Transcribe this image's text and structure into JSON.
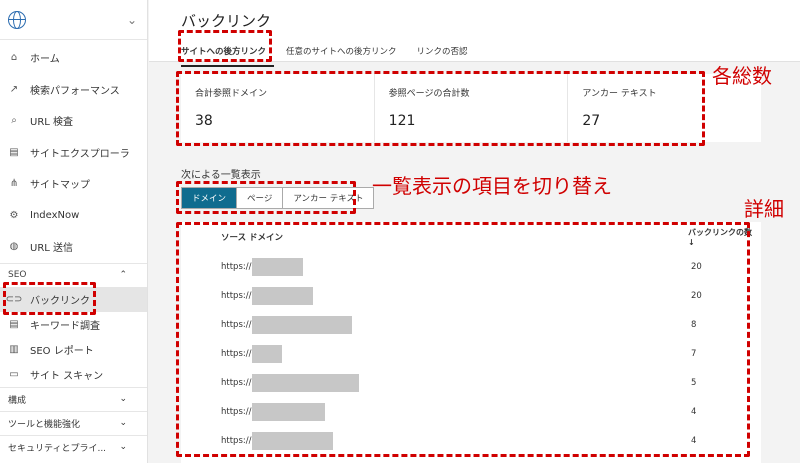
{
  "sidebar": {
    "items": [
      {
        "label": "ホーム",
        "icon": "home-icon",
        "glyph": "⌂"
      },
      {
        "label": "検索パフォーマンス",
        "icon": "trend-icon",
        "glyph": "↗"
      },
      {
        "label": "URL 検査",
        "icon": "search-icon",
        "glyph": "⌕"
      },
      {
        "label": "サイトエクスプローラ",
        "icon": "document-icon",
        "glyph": "▤"
      },
      {
        "label": "サイトマップ",
        "icon": "sitemap-icon",
        "glyph": "⋔"
      },
      {
        "label": "IndexNow",
        "icon": "gear-icon",
        "glyph": "⚙"
      },
      {
        "label": "URL 送信",
        "icon": "globe-icon",
        "glyph": "◍"
      }
    ],
    "seo_section": "SEO",
    "seo_items": [
      {
        "label": "バックリンク",
        "icon": "link-icon",
        "glyph": "⊂⊃"
      },
      {
        "label": "キーワード調査",
        "icon": "document-icon",
        "glyph": "▤"
      },
      {
        "label": "SEO レポート",
        "icon": "report-icon",
        "glyph": "▥"
      },
      {
        "label": "サイト スキャン",
        "icon": "scan-icon",
        "glyph": "▭"
      }
    ],
    "collapsed": [
      "構成",
      "ツールと機能強化",
      "セキュリティとプライ..."
    ]
  },
  "header": {
    "title": "バックリンク",
    "tabs": [
      "サイトへの後方リンク",
      "任意のサイトへの後方リンク",
      "リンクの否認"
    ]
  },
  "stats": [
    {
      "label": "合計参照ドメイン",
      "value": "38"
    },
    {
      "label": "参照ページの合計数",
      "value": "121"
    },
    {
      "label": "アンカー テキスト",
      "value": "27"
    }
  ],
  "list": {
    "caption": "次による一覧表示",
    "toggles": [
      "ドメイン",
      "ページ",
      "アンカー テキスト"
    ]
  },
  "table": {
    "col_source": "ソース ドメイン",
    "col_count": "バックリンクの数 ↓",
    "rows": [
      {
        "prefix": "https://",
        "count": "20",
        "redact_fraction": 0.39
      },
      {
        "prefix": "https://",
        "count": "20",
        "redact_fraction": 0.47
      },
      {
        "prefix": "https://",
        "count": "8",
        "redact_fraction": 0.77
      },
      {
        "prefix": "https://",
        "count": "7",
        "redact_fraction": 0.23
      },
      {
        "prefix": "https://",
        "count": "5",
        "redact_fraction": 0.82
      },
      {
        "prefix": "https://",
        "count": "4",
        "redact_fraction": 0.56
      },
      {
        "prefix": "https://",
        "count": "4",
        "redact_fraction": 0.62
      }
    ]
  },
  "annotations": {
    "totals": "各総数",
    "switch": "一覧表示の項目を切り替え",
    "details": "詳細",
    "color": "#d00000"
  }
}
